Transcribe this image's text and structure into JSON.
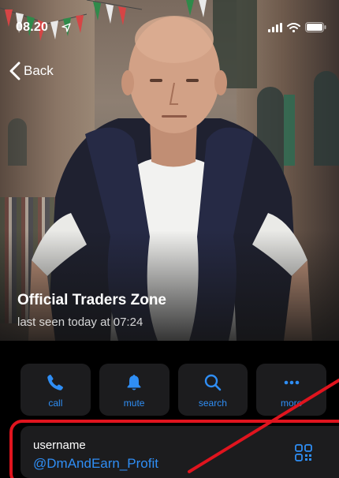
{
  "status_bar": {
    "time": "08.20"
  },
  "nav": {
    "back_label": "Back"
  },
  "profile": {
    "name": "Official Traders Zone",
    "last_seen": "last seen today at 07:24"
  },
  "actions": [
    {
      "label": "call",
      "icon": "phone-icon"
    },
    {
      "label": "mute",
      "icon": "bell-icon"
    },
    {
      "label": "search",
      "icon": "magnifier-icon"
    },
    {
      "label": "more",
      "icon": "ellipsis-icon"
    }
  ],
  "info": {
    "title": "username",
    "value": "@DmAndEarn_Profit",
    "icon": "qr-code-icon"
  },
  "colors": {
    "accent": "#2f8ef5",
    "card_bg": "#1c1c1e",
    "annotation": "#e0141e"
  }
}
